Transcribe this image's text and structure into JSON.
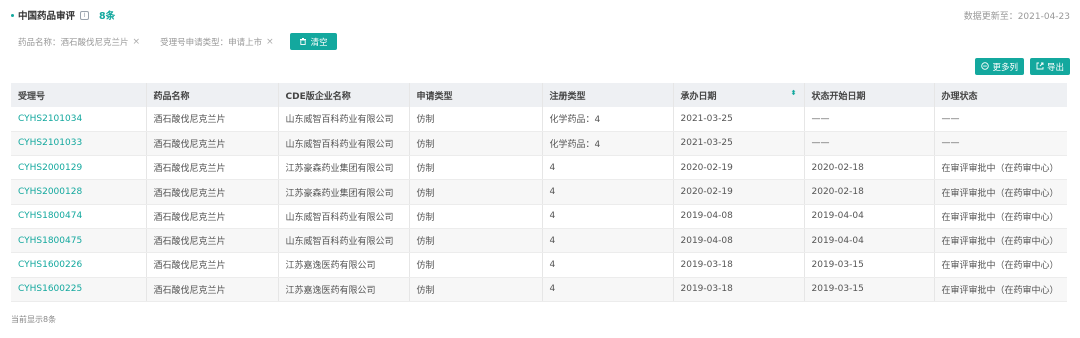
{
  "header": {
    "title": "中国药品审评",
    "info_icon": "i",
    "count": "8条",
    "updated": "数据更新至：2021-04-23"
  },
  "filters": [
    {
      "label": "药品名称：酒石酸伐尼克兰片",
      "close": "×"
    },
    {
      "label": "受理号申请类型：申请上市",
      "close": "×"
    }
  ],
  "clear_label": "清空",
  "actions": {
    "more_label": "更多列",
    "export_label": "导出"
  },
  "table": {
    "columns": [
      "受理号",
      "药品名称",
      "CDE版企业名称",
      "申请类型",
      "注册类型",
      "承办日期",
      "状态开始日期",
      "办理状态"
    ],
    "sort_icon": "⬍",
    "rows": [
      [
        "CYHS2101034",
        "酒石酸伐尼克兰片",
        "山东威智百科药业有限公司",
        "仿制",
        "化学药品：4",
        "2021-03-25",
        "——",
        "——"
      ],
      [
        "CYHS2101033",
        "酒石酸伐尼克兰片",
        "山东威智百科药业有限公司",
        "仿制",
        "化学药品：4",
        "2021-03-25",
        "——",
        "——"
      ],
      [
        "CYHS2000129",
        "酒石酸伐尼克兰片",
        "江苏豪森药业集团有限公司",
        "仿制",
        "4",
        "2020-02-19",
        "2020-02-18",
        "在审评审批中（在药审中心）"
      ],
      [
        "CYHS2000128",
        "酒石酸伐尼克兰片",
        "江苏豪森药业集团有限公司",
        "仿制",
        "4",
        "2020-02-19",
        "2020-02-18",
        "在审评审批中（在药审中心）"
      ],
      [
        "CYHS1800474",
        "酒石酸伐尼克兰片",
        "山东威智百科药业有限公司",
        "仿制",
        "4",
        "2019-04-08",
        "2019-04-04",
        "在审评审批中（在药审中心）"
      ],
      [
        "CYHS1800475",
        "酒石酸伐尼克兰片",
        "山东威智百科药业有限公司",
        "仿制",
        "4",
        "2019-04-08",
        "2019-04-04",
        "在审评审批中（在药审中心）"
      ],
      [
        "CYHS1600226",
        "酒石酸伐尼克兰片",
        "江苏嘉逸医药有限公司",
        "仿制",
        "4",
        "2019-03-18",
        "2019-03-15",
        "在审评审批中（在药审中心）"
      ],
      [
        "CYHS1600225",
        "酒石酸伐尼克兰片",
        "江苏嘉逸医药有限公司",
        "仿制",
        "4",
        "2019-03-18",
        "2019-03-15",
        "在审评审批中（在药审中心）"
      ]
    ]
  },
  "footer": "当前显示8条",
  "colors": {
    "accent": "#13a89e",
    "header_bg": "#eef0f3",
    "stripe": "#f7f7f7"
  }
}
